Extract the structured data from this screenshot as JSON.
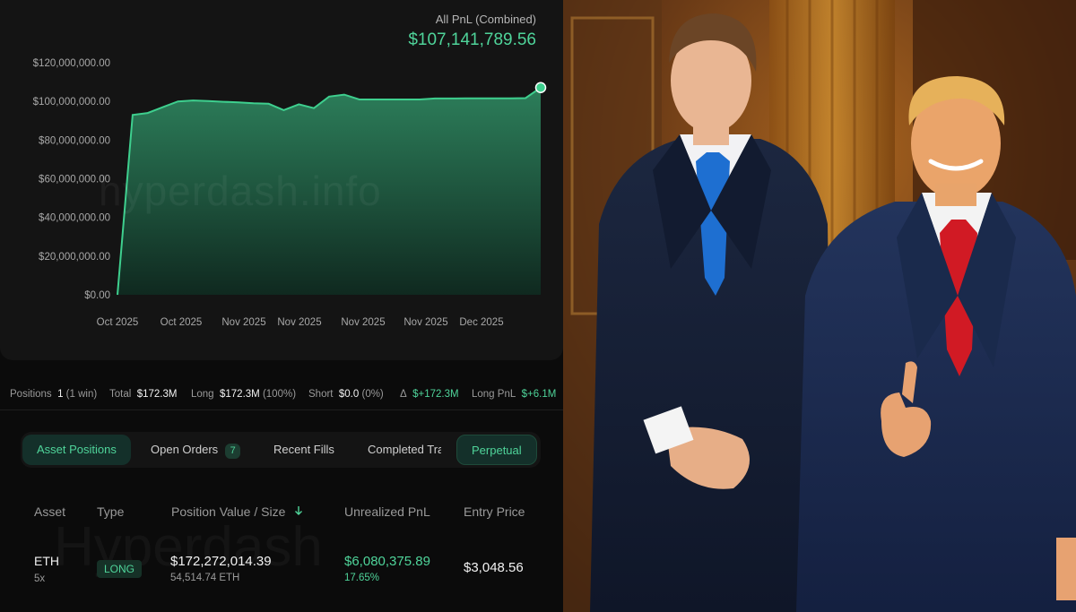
{
  "header": {
    "label": "All PnL (Combined)",
    "value": "$107,141,789.56"
  },
  "chart_data": {
    "type": "area",
    "title": "",
    "xlabel": "",
    "ylabel": "",
    "ylim": [
      0,
      120000000
    ],
    "yticks": [
      "$120,000,000.00",
      "$100,000,000.00",
      "$80,000,000.00",
      "$60,000,000.00",
      "$40,000,000.00",
      "$20,000,000.00",
      "$0.00"
    ],
    "xticks": [
      "Oct 2025",
      "Oct 2025",
      "Nov 2025",
      "Nov 2025",
      "Nov 2025",
      "Nov 2025",
      "Dec 2025"
    ],
    "grid": false,
    "color": "#3ecf8e",
    "series": [
      {
        "values": [
          0,
          93000000,
          94000000,
          97000000,
          100000000,
          100500000,
          100200000,
          99800000,
          99500000,
          99000000,
          98800000,
          95500000,
          98500000,
          96500000,
          102500000,
          103500000,
          101000000,
          101000000,
          101000000,
          101000000,
          101000000,
          101500000,
          101500000,
          101600000,
          101600000,
          101600000,
          101600000,
          101700000,
          107141789.56
        ]
      }
    ]
  },
  "watermark": "hyperdash.info",
  "stats": {
    "positions_label": "Positions",
    "positions_value": "1",
    "positions_note": "(1 win)",
    "total_label": "Total",
    "total_value": "$172.3M",
    "long_label": "Long",
    "long_value": "$172.3M",
    "long_pct": "(100%)",
    "short_label": "Short",
    "short_value": "$0.0",
    "short_pct": "(0%)",
    "delta_label": "Δ",
    "delta_value": "$+172.3M",
    "longpnl_label": "Long PnL",
    "longpnl_value": "$+6.1M"
  },
  "tabs": {
    "asset_positions": "Asset Positions",
    "open_orders": "Open Orders",
    "open_orders_count": "7",
    "recent_fills": "Recent Fills",
    "completed": "Completed Trades",
    "perpetual": "Perpetual"
  },
  "table": {
    "headers": {
      "asset": "Asset",
      "type": "Type",
      "position": "Position Value / Size",
      "unrealized": "Unrealized PnL",
      "entry": "Entry Price"
    },
    "rows": [
      {
        "asset": "ETH",
        "leverage": "5x",
        "type": "LONG",
        "position_value": "$172,272,014.39",
        "size": "54,514.74 ETH",
        "unrealized_pnl": "$6,080,375.89",
        "unrealized_pct": "17.65%",
        "entry_price": "$3,048.56"
      }
    ],
    "watermark": "Hyperdash"
  },
  "colors": {
    "accent": "#4fd49a",
    "background": "#0b0b0b",
    "card": "#141414"
  }
}
